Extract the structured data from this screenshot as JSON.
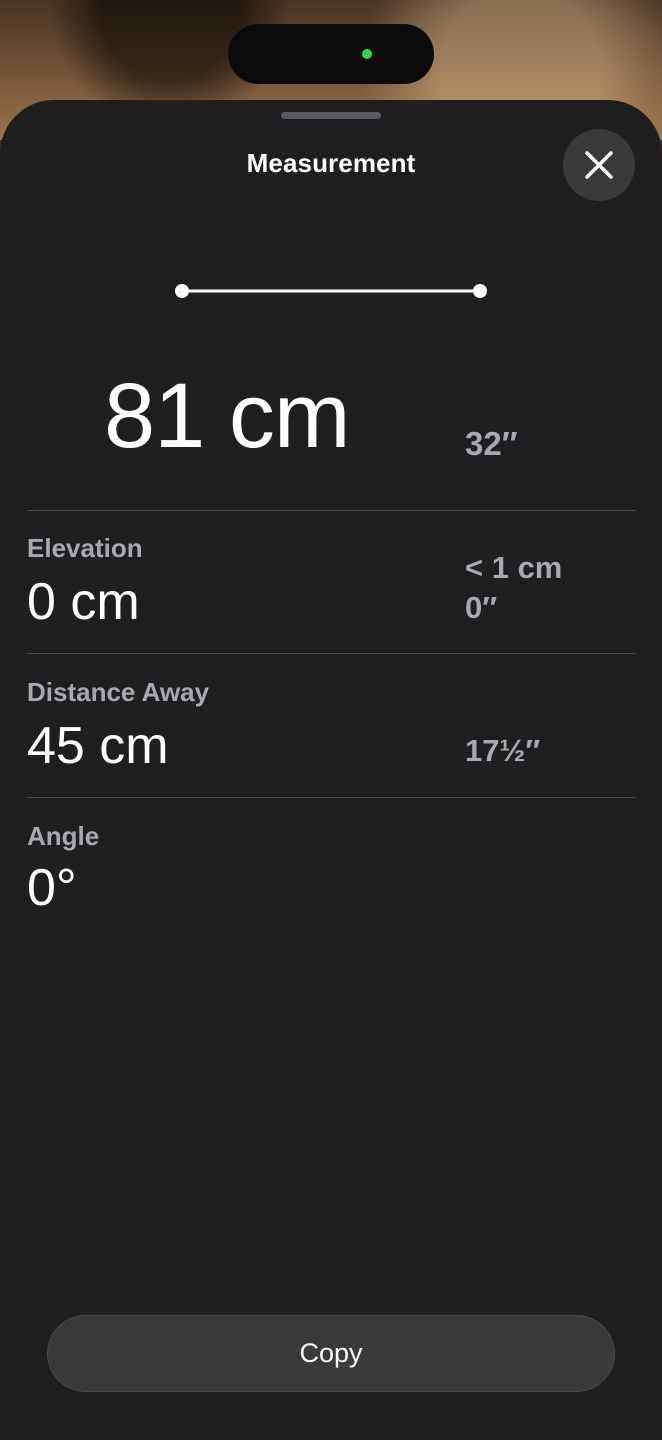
{
  "status": {
    "indicator_color": "#32d74b"
  },
  "sheet": {
    "title": "Measurement",
    "close_icon": "close-icon"
  },
  "primary_measurement": {
    "value": "81 cm",
    "imperial": "32″"
  },
  "rows": {
    "elevation": {
      "label": "Elevation",
      "value": "0 cm",
      "secondary_line1": "< 1 cm",
      "secondary_line2": "0″"
    },
    "distance_away": {
      "label": "Distance Away",
      "value": "45 cm",
      "secondary": "17½″"
    },
    "angle": {
      "label": "Angle",
      "value": "0°"
    }
  },
  "actions": {
    "copy_label": "Copy"
  },
  "colors": {
    "sheet_bg": "#1f1f21",
    "secondary_text": "#a8a8ad",
    "button_bg": "#3a3a3c"
  }
}
